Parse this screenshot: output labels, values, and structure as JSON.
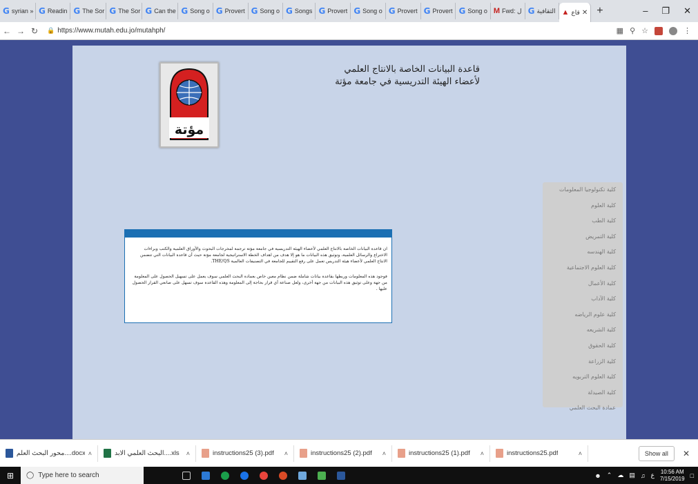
{
  "browser": {
    "tabs": [
      {
        "icon": "G",
        "label": "syrian »"
      },
      {
        "icon": "G",
        "label": "Readin"
      },
      {
        "icon": "G",
        "label": "The Sor"
      },
      {
        "icon": "G",
        "label": "The Sor"
      },
      {
        "icon": "G",
        "label": "Can the"
      },
      {
        "icon": "G",
        "label": "Song o"
      },
      {
        "icon": "G",
        "label": "Provert"
      },
      {
        "icon": "G",
        "label": "Song o"
      },
      {
        "icon": "G",
        "label": "Songs"
      },
      {
        "icon": "G",
        "label": "Provert"
      },
      {
        "icon": "G",
        "label": "Song o"
      },
      {
        "icon": "G",
        "label": "Provert"
      },
      {
        "icon": "G",
        "label": "Provert"
      },
      {
        "icon": "G",
        "label": "Song o"
      },
      {
        "icon": "M",
        "label": "Fwd: ل"
      },
      {
        "icon": "G",
        "label": "الثقافية"
      }
    ],
    "active_tab": {
      "label": "قاع"
    },
    "new_tab": "+",
    "url": "https://www.mutah.edu.jo/mutahph/",
    "colors": {
      "accent": "#1b6fb3",
      "page_bg": "#3f4e93",
      "panel_bg": "#c8d4e8"
    }
  },
  "page": {
    "title_line1": "قاعدة البيانات الخاصة بالانتاج العلمي",
    "title_line2": "لأعضاء الهيئة التدريسية في جامعة مؤتة",
    "logo_text": "مؤتة",
    "info_p1": "ان قاعدة البيانات الخاصة بالانتاج العلمي لأعضاء الهيئة التدريسية في جامعة مؤتة ترجمة لمخرجات البحوث والأوراق العلمية والكتب وبراءات الاختراع والرسائل العلمية، وتوثيق هذه البيانات ما هو إلا هدف من اهداف الخطة الاستراتيجية لجامعة مؤتة حيث أن قاعدة البيانات التي تتضمن الانتاج العلمي لأعضاء هيئة التدريس تعمل على رفع التقييم للجامعة في التصنيفات العالمية THE/QS.",
    "info_p2": "فوجود هذه المعلومات وربطها بقاعدة بيانات شاملة ضمن نظام معين خاص بعمادة البحث العلمي سوف يعمل على تسهيل الحصول على المعلومة من جهة وعلى توثيق هذه البيانات من جهة أخرى، ولعل صناعة أي قرار بحاجة إلى المعلومة وهذه القاعدة سوف تسهل على صانعي القرار الحصول عليها .",
    "menu": [
      "كلية تكنولوجيا المعلومات",
      "كلية العلوم",
      "كلية الطب",
      "كلية التمريض",
      "كلية الهندسه",
      "كلية العلوم الاجتماعية",
      "كلية الأعمال",
      "كلية الآداب",
      "كلية علوم الرياضه",
      "كلية الشريعه",
      "كلية الحقوق",
      "كلية الزراعة",
      "كلية العلوم التربويه",
      "كلية الصيدلة",
      "عمادة البحث العلمي"
    ]
  },
  "downloads": {
    "items": [
      {
        "name": "محور البحث العلم....docx",
        "icon": "word-file-icon",
        "color": "#2b579a"
      },
      {
        "name": "البحث العلمي الابد....xls",
        "icon": "excel-file-icon",
        "color": "#217346"
      },
      {
        "name": "instructions25 (3).pdf",
        "icon": "pdf-file-icon",
        "color": "#e8a08a"
      },
      {
        "name": "instructions25 (2).pdf",
        "icon": "pdf-file-icon",
        "color": "#e8a08a"
      },
      {
        "name": "instructions25 (1).pdf",
        "icon": "pdf-file-icon",
        "color": "#e8a08a"
      },
      {
        "name": "instructions25.pdf",
        "icon": "pdf-file-icon",
        "color": "#e8a08a"
      }
    ],
    "show_all": "Show all"
  },
  "taskbar": {
    "search_placeholder": "Type here to search",
    "time": "10:56 AM",
    "date": "7/15/2019",
    "lang": "ع"
  }
}
